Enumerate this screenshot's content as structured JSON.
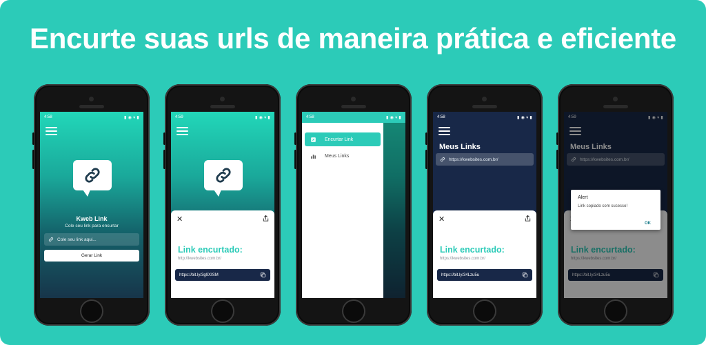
{
  "headline": "Encurte suas urls de maneira prática e eficiente",
  "colors": {
    "background": "#2ccbb8",
    "accent": "#2ccbb8",
    "navy": "#182848",
    "white": "#ffffff"
  },
  "status_times": [
    "4:58",
    "4:59",
    "4:58",
    "4:58",
    "4:59"
  ],
  "home": {
    "app_name": "Kweb Link",
    "subtitle": "Cole seu link para encurtar",
    "input_placeholder": "Cole seu link aqui...",
    "generate_button": "Gerar Link"
  },
  "result_sheet": {
    "label": "Link encurtado:",
    "original_url_home": "http://kwebsites.com.br/",
    "short_url_home": "https://bit.ly/3g9XISM",
    "original_url_mylinks": "https://kwebsites.com.br/",
    "short_url_mylinks": "https://bit.ly/34Lzu5u"
  },
  "drawer": {
    "items": [
      {
        "label": "Encurtar Link",
        "icon": "link-icon",
        "active": true
      },
      {
        "label": "Meus Links",
        "icon": "chart-icon",
        "active": false
      }
    ]
  },
  "my_links": {
    "title": "Meus Links",
    "items": [
      "https://kwebsites.com.br/"
    ]
  },
  "alert": {
    "title": "Alert",
    "message": "Link copiado com sucesso!",
    "ok": "OK"
  }
}
